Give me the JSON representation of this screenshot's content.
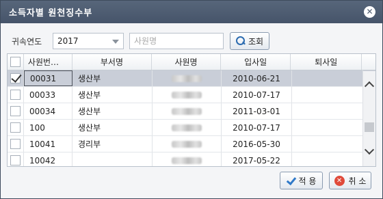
{
  "dialog": {
    "title": "소득자별 원천징수부",
    "close_glyph": "✕"
  },
  "filter": {
    "year_label": "귀속연도",
    "year_value": "2017",
    "name_placeholder": "사원명",
    "search_label": "조회"
  },
  "grid": {
    "headers": {
      "emp_id": "사원번…",
      "dept": "부서명",
      "name": "사원명",
      "join_date": "입사일",
      "quit_date": "퇴사일"
    },
    "rows": [
      {
        "checked": true,
        "emp_id": "00031",
        "dept": "생산부",
        "join_date": "2010-06-21",
        "quit_date": ""
      },
      {
        "checked": false,
        "emp_id": "00033",
        "dept": "생산부",
        "join_date": "2010-07-17",
        "quit_date": ""
      },
      {
        "checked": false,
        "emp_id": "00034",
        "dept": "생산부",
        "join_date": "2011-03-01",
        "quit_date": ""
      },
      {
        "checked": false,
        "emp_id": "100",
        "dept": "생산부",
        "join_date": "2010-07-17",
        "quit_date": ""
      },
      {
        "checked": false,
        "emp_id": "10041",
        "dept": "경리부",
        "join_date": "2016-05-30",
        "quit_date": ""
      },
      {
        "checked": false,
        "emp_id": "10042",
        "dept": "",
        "join_date": "2017-05-22",
        "quit_date": ""
      }
    ]
  },
  "buttons": {
    "apply_label": "적 용",
    "cancel_label": "취 소"
  },
  "icons": {
    "search": "search-icon",
    "apply": "check-icon",
    "cancel": "cancel-icon",
    "close": "close-icon"
  },
  "colors": {
    "titlebar": "#4f5d72",
    "selected_row": "#c9ced8",
    "accent_blue": "#2f79c8",
    "cancel_red": "#e04a3a"
  }
}
